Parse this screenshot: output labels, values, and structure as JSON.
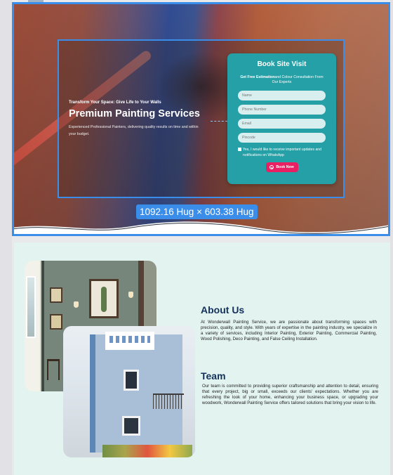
{
  "hero": {
    "eyebrow": "Transform Your Space: Give Life to Your Walls",
    "title": "Premium Painting Services",
    "description": "Experienced Professional Painters, delivering quality results on time and within your budget.",
    "size_badge": "1092.16 Hug × 603.38 Hug",
    "accent_color": "#3b8dea"
  },
  "booking": {
    "title": "Book Site Visit",
    "subtitle_bold": "Get Free Estimation",
    "subtitle_rest": "and Colour Consultation From Our Experts",
    "fields": {
      "name_placeholder": "Name",
      "phone_placeholder": "Phone Number",
      "email_placeholder": "Email",
      "pincode_placeholder": "Pincode"
    },
    "consent_label": "Yes, I would like to receive important updates and notifications on WhatsApp",
    "button_label": "Book Now",
    "button_icon": "check-circle-icon",
    "card_color": "#24a0a6",
    "button_color": "#e91e63"
  },
  "about": {
    "heading": "About Us",
    "body": "At Wonderwall Painting Service, we are passionate about transforming spaces with precision, quality, and style. With years of expertise in the painting industry, we specialize in a variety of services, including Interior Painting, Exterior Painting, Commercial Painting, Wood Polishing, Deco Painting, and False Ceiling Installation."
  },
  "team": {
    "heading": "Team",
    "body": "Our team is committed to providing superior craftsmanship and attention to detail, ensuring that every project, big or small, exceeds our clients' expectations. Whether you are refreshing the look of your home, enhancing your business space, or upgrading your woodwork, Wonderwall Painting Service offers tailored solutions that bring your vision to life."
  }
}
